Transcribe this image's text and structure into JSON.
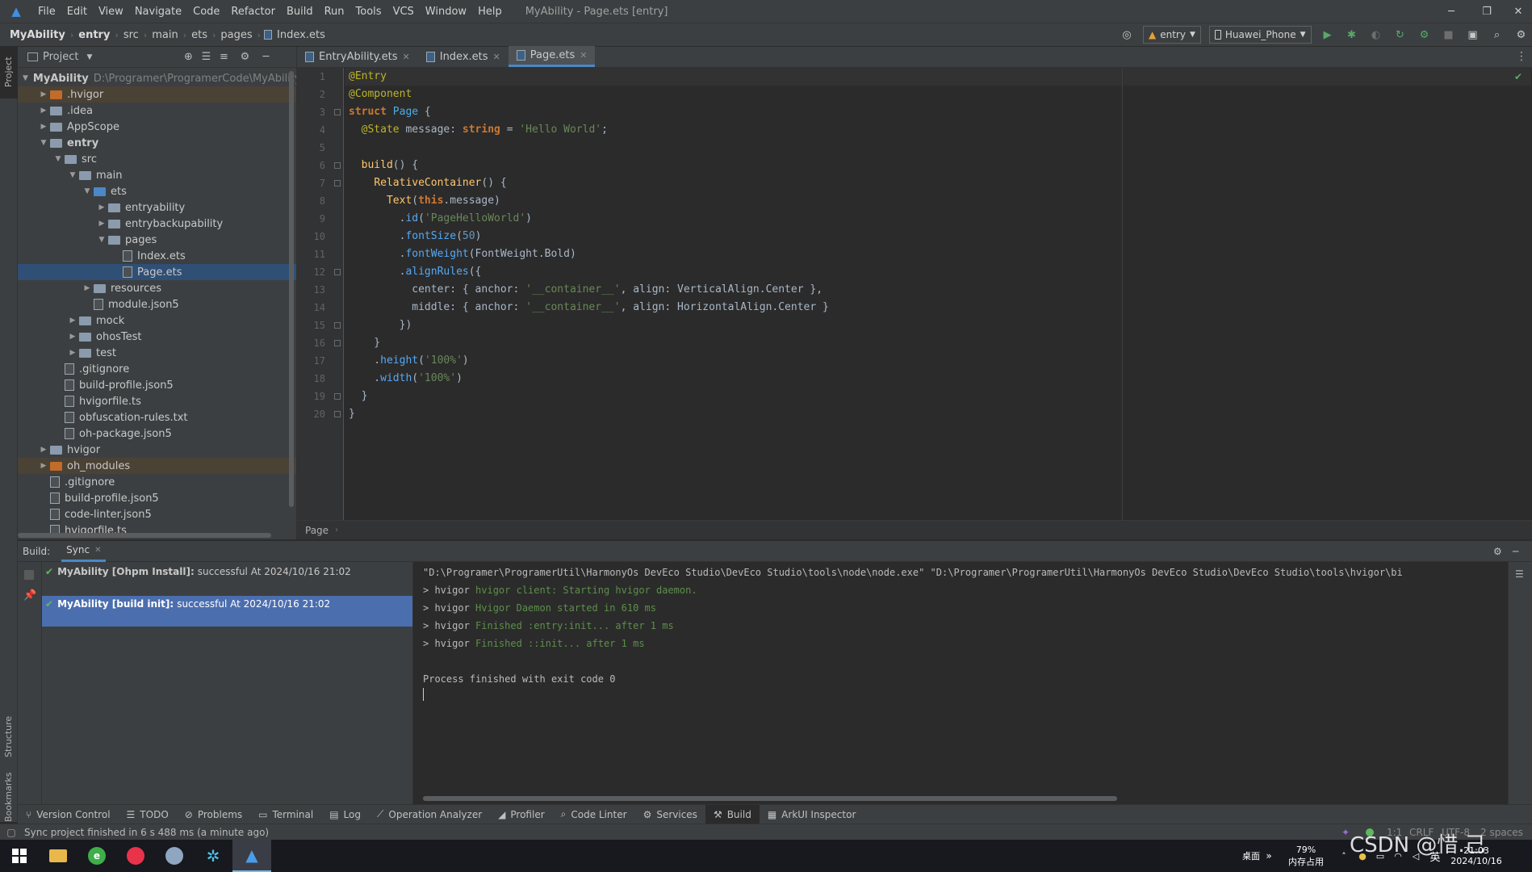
{
  "menubar": {
    "items": [
      "File",
      "Edit",
      "View",
      "Navigate",
      "Code",
      "Refactor",
      "Build",
      "Run",
      "Tools",
      "VCS",
      "Window",
      "Help"
    ],
    "title": "MyAbility - Page.ets [entry]"
  },
  "navbar": {
    "crumbs": [
      "MyAbility",
      "entry",
      "src",
      "main",
      "ets",
      "pages",
      "Index.ets"
    ],
    "run_config": "entry",
    "device": "Huawei_Phone"
  },
  "left_strip": {
    "project_tab": "Project",
    "structure_tab": "Structure",
    "bookmarks_tab": "Bookmarks"
  },
  "project": {
    "header": "Project",
    "tree": [
      {
        "label": "MyAbility",
        "path": "D:\\Programer\\ProgramerCode\\MyAbility",
        "depth": 0,
        "type": "folder",
        "open": true
      },
      {
        "label": ".hvigor",
        "depth": 1,
        "type": "folder-orange",
        "open": false
      },
      {
        "label": ".idea",
        "depth": 1,
        "type": "folder",
        "open": false
      },
      {
        "label": "AppScope",
        "depth": 1,
        "type": "folder",
        "open": false
      },
      {
        "label": "entry",
        "depth": 1,
        "type": "folder",
        "open": true
      },
      {
        "label": "src",
        "depth": 2,
        "type": "folder",
        "open": true
      },
      {
        "label": "main",
        "depth": 3,
        "type": "folder",
        "open": true
      },
      {
        "label": "ets",
        "depth": 4,
        "type": "folder-blue",
        "open": true
      },
      {
        "label": "entryability",
        "depth": 5,
        "type": "folder",
        "open": false
      },
      {
        "label": "entrybackupability",
        "depth": 5,
        "type": "folder",
        "open": false
      },
      {
        "label": "pages",
        "depth": 5,
        "type": "folder",
        "open": true
      },
      {
        "label": "Index.ets",
        "depth": 6,
        "type": "file"
      },
      {
        "label": "Page.ets",
        "depth": 6,
        "type": "file",
        "selected": true
      },
      {
        "label": "resources",
        "depth": 4,
        "type": "folder",
        "open": false
      },
      {
        "label": "module.json5",
        "depth": 4,
        "type": "file"
      },
      {
        "label": "mock",
        "depth": 3,
        "type": "folder",
        "open": false
      },
      {
        "label": "ohosTest",
        "depth": 3,
        "type": "folder",
        "open": false
      },
      {
        "label": "test",
        "depth": 3,
        "type": "folder",
        "open": false
      },
      {
        "label": ".gitignore",
        "depth": 2,
        "type": "file"
      },
      {
        "label": "build-profile.json5",
        "depth": 2,
        "type": "file"
      },
      {
        "label": "hvigorfile.ts",
        "depth": 2,
        "type": "file"
      },
      {
        "label": "obfuscation-rules.txt",
        "depth": 2,
        "type": "file"
      },
      {
        "label": "oh-package.json5",
        "depth": 2,
        "type": "file"
      },
      {
        "label": "hvigor",
        "depth": 1,
        "type": "folder",
        "open": false
      },
      {
        "label": "oh_modules",
        "depth": 1,
        "type": "folder-orange",
        "open": false
      },
      {
        "label": ".gitignore",
        "depth": 1,
        "type": "file"
      },
      {
        "label": "build-profile.json5",
        "depth": 1,
        "type": "file"
      },
      {
        "label": "code-linter.json5",
        "depth": 1,
        "type": "file"
      },
      {
        "label": "hvigorfile.ts",
        "depth": 1,
        "type": "file"
      }
    ]
  },
  "editor": {
    "tabs": [
      {
        "label": "EntryAbility.ets",
        "active": false
      },
      {
        "label": "Index.ets",
        "active": false
      },
      {
        "label": "Page.ets",
        "active": true
      }
    ],
    "line_numbers": [
      "1",
      "2",
      "3",
      "4",
      "5",
      "6",
      "7",
      "8",
      "9",
      "10",
      "11",
      "12",
      "13",
      "14",
      "15",
      "16",
      "17",
      "18",
      "19",
      "20"
    ],
    "lines": [
      [
        {
          "t": "@Entry",
          "c": "ann"
        }
      ],
      [
        {
          "t": "@Component",
          "c": "ann"
        }
      ],
      [
        {
          "t": "struct ",
          "c": "kw"
        },
        {
          "t": "Page",
          "c": "cls"
        },
        {
          "t": " {",
          "c": "plain"
        }
      ],
      [
        {
          "t": "  @State",
          "c": "ann"
        },
        {
          "t": " message: ",
          "c": "plain"
        },
        {
          "t": "string",
          "c": "kw"
        },
        {
          "t": " = ",
          "c": "plain"
        },
        {
          "t": "'Hello World'",
          "c": "str"
        },
        {
          "t": ";",
          "c": "plain"
        }
      ],
      [],
      [
        {
          "t": "  ",
          "c": "plain"
        },
        {
          "t": "build",
          "c": "fn"
        },
        {
          "t": "() {",
          "c": "plain"
        }
      ],
      [
        {
          "t": "    ",
          "c": "plain"
        },
        {
          "t": "RelativeContainer",
          "c": "fn"
        },
        {
          "t": "() {",
          "c": "plain"
        }
      ],
      [
        {
          "t": "      ",
          "c": "plain"
        },
        {
          "t": "Text",
          "c": "fn"
        },
        {
          "t": "(",
          "c": "plain"
        },
        {
          "t": "this",
          "c": "kw"
        },
        {
          "t": ".message)",
          "c": "plain"
        }
      ],
      [
        {
          "t": "        .",
          "c": "plain"
        },
        {
          "t": "id",
          "c": "meth"
        },
        {
          "t": "(",
          "c": "plain"
        },
        {
          "t": "'PageHelloWorld'",
          "c": "str"
        },
        {
          "t": ")",
          "c": "plain"
        }
      ],
      [
        {
          "t": "        .",
          "c": "plain"
        },
        {
          "t": "fontSize",
          "c": "meth"
        },
        {
          "t": "(",
          "c": "plain"
        },
        {
          "t": "50",
          "c": "num"
        },
        {
          "t": ")",
          "c": "plain"
        }
      ],
      [
        {
          "t": "        .",
          "c": "plain"
        },
        {
          "t": "fontWeight",
          "c": "meth"
        },
        {
          "t": "(FontWeight.Bold)",
          "c": "plain"
        }
      ],
      [
        {
          "t": "        .",
          "c": "plain"
        },
        {
          "t": "alignRules",
          "c": "meth"
        },
        {
          "t": "({",
          "c": "plain"
        }
      ],
      [
        {
          "t": "          center: { anchor: ",
          "c": "plain"
        },
        {
          "t": "'__container__'",
          "c": "str"
        },
        {
          "t": ", align: VerticalAlign.Center },",
          "c": "plain"
        }
      ],
      [
        {
          "t": "          middle: { anchor: ",
          "c": "plain"
        },
        {
          "t": "'__container__'",
          "c": "str"
        },
        {
          "t": ", align: HorizontalAlign.Center }",
          "c": "plain"
        }
      ],
      [
        {
          "t": "        })",
          "c": "plain"
        }
      ],
      [
        {
          "t": "    }",
          "c": "plain"
        }
      ],
      [
        {
          "t": "    .",
          "c": "plain"
        },
        {
          "t": "height",
          "c": "meth"
        },
        {
          "t": "(",
          "c": "plain"
        },
        {
          "t": "'100%'",
          "c": "str"
        },
        {
          "t": ")",
          "c": "plain"
        }
      ],
      [
        {
          "t": "    .",
          "c": "plain"
        },
        {
          "t": "width",
          "c": "meth"
        },
        {
          "t": "(",
          "c": "plain"
        },
        {
          "t": "'100%'",
          "c": "str"
        },
        {
          "t": ")",
          "c": "plain"
        }
      ],
      [
        {
          "t": "  }",
          "c": "plain"
        }
      ],
      [
        {
          "t": "}",
          "c": "plain"
        }
      ]
    ],
    "footer_crumb": "Page"
  },
  "build": {
    "label": "Build:",
    "tab": "Sync",
    "items": [
      {
        "title": "MyAbility [Ohpm Install]:",
        "status": "successful At 2024/10/16 21:02",
        "selected": false
      },
      {
        "title": "MyAbility [build init]:",
        "status": "successful At 2024/10/16 21:02",
        "selected": true
      }
    ],
    "console": [
      {
        "prefix": "\"D:\\Programer\\ProgramerUtil\\HarmonyOs DevEco Studio\\DevEco Studio\\tools\\node\\node.exe\" \"D:\\Programer\\ProgramerUtil\\HarmonyOs DevEco Studio\\DevEco Studio\\tools\\hvigor\\bi",
        "green": ""
      },
      {
        "prefix": "> hvigor ",
        "green": "hvigor client: Starting hvigor daemon."
      },
      {
        "prefix": "> hvigor ",
        "green": "Hvigor Daemon started in 610 ms"
      },
      {
        "prefix": "> hvigor ",
        "green": "Finished :entry:init... after 1 ms"
      },
      {
        "prefix": "> hvigor ",
        "green": "Finished ::init... after 1 ms"
      },
      {
        "prefix": "",
        "green": ""
      },
      {
        "prefix": "Process finished with exit code 0",
        "green": ""
      }
    ]
  },
  "tool_windows": [
    {
      "label": "Version Control",
      "icon": "branch-icon",
      "active": false
    },
    {
      "label": "TODO",
      "icon": "list-icon",
      "active": false
    },
    {
      "label": "Problems",
      "icon": "warning-icon",
      "active": false
    },
    {
      "label": "Terminal",
      "icon": "terminal-icon",
      "active": false
    },
    {
      "label": "Log",
      "icon": "log-icon",
      "active": false
    },
    {
      "label": "Operation Analyzer",
      "icon": "analyzer-icon",
      "active": false
    },
    {
      "label": "Profiler",
      "icon": "profiler-icon",
      "active": false
    },
    {
      "label": "Code Linter",
      "icon": "linter-icon",
      "active": false
    },
    {
      "label": "Services",
      "icon": "services-icon",
      "active": false
    },
    {
      "label": "Build",
      "icon": "hammer-icon",
      "active": true
    },
    {
      "label": "ArkUI Inspector",
      "icon": "inspector-icon",
      "active": false
    }
  ],
  "statusbar": {
    "message": "Sync project finished in 6 s 488 ms (a minute ago)",
    "position": "1:1",
    "line_sep": "CRLF",
    "encoding": "UTF-8",
    "indent": "2 spaces"
  },
  "taskbar": {
    "desktop_label": "桌面",
    "memory_percent": "79%",
    "memory_label": "内存占用",
    "ime": "英",
    "time": "21:03",
    "date": "2024/10/16",
    "watermark": "CSDN @惜.己"
  }
}
